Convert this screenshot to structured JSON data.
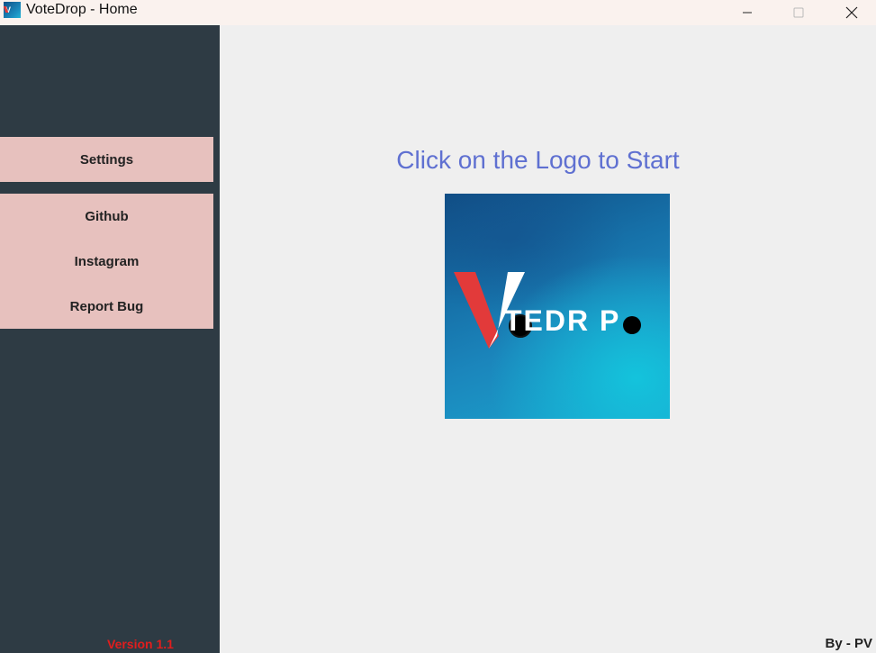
{
  "window": {
    "title": "VoteDrop - Home",
    "controls": [
      "minimize",
      "maximize",
      "close"
    ]
  },
  "sidebar": {
    "settings_label": "Settings",
    "links": [
      {
        "label": "Github"
      },
      {
        "label": "Instagram"
      },
      {
        "label": "Report Bug"
      }
    ],
    "version": "Version 1.1"
  },
  "main": {
    "heading": "Click on the Logo to Start",
    "logo": {
      "text": "VOTEDROP",
      "text_shown": "TEDR P",
      "icon": "votedrop-logo"
    },
    "credit": "By - PV"
  },
  "colors": {
    "sidebar_bg": "#2e3b44",
    "sidebar_button_bg": "#e7c1be",
    "main_bg": "#efefef",
    "heading": "#5f70d1",
    "version": "#e11d1d",
    "logo_v_red": "#e23a3a"
  }
}
